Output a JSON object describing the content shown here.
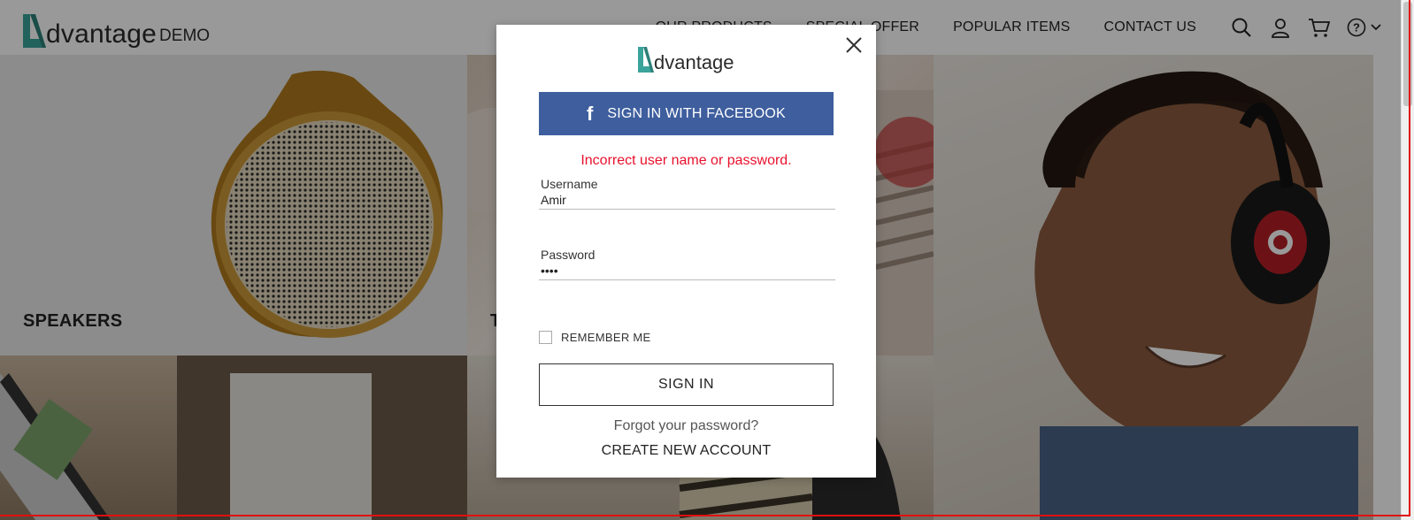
{
  "header": {
    "logo_text": "dvantage",
    "logo_demo": "DEMO",
    "nav": [
      "OUR PRODUCTS",
      "SPECIAL OFFER",
      "POPULAR ITEMS",
      "CONTACT US"
    ],
    "icons": [
      "search-icon",
      "user-icon",
      "cart-icon",
      "help-icon",
      "chevron-down-icon"
    ]
  },
  "categories": {
    "speakers": "SPEAKERS",
    "tablets": "T"
  },
  "login_modal": {
    "logo_text": "dvantage",
    "facebook_label": "SIGN IN WITH FACEBOOK",
    "error": "Incorrect user name or password.",
    "username_label": "Username",
    "username_value": "Amir",
    "password_label": "Password",
    "password_value": "••••",
    "remember_label": "REMEMBER ME",
    "signin_label": "SIGN IN",
    "forgot_label": "Forgot your password?",
    "create_label": "CREATE NEW ACCOUNT"
  },
  "colors": {
    "brand_teal": "#3aa39a",
    "facebook_blue": "#3e5e9e",
    "error_red": "#e8112d"
  }
}
